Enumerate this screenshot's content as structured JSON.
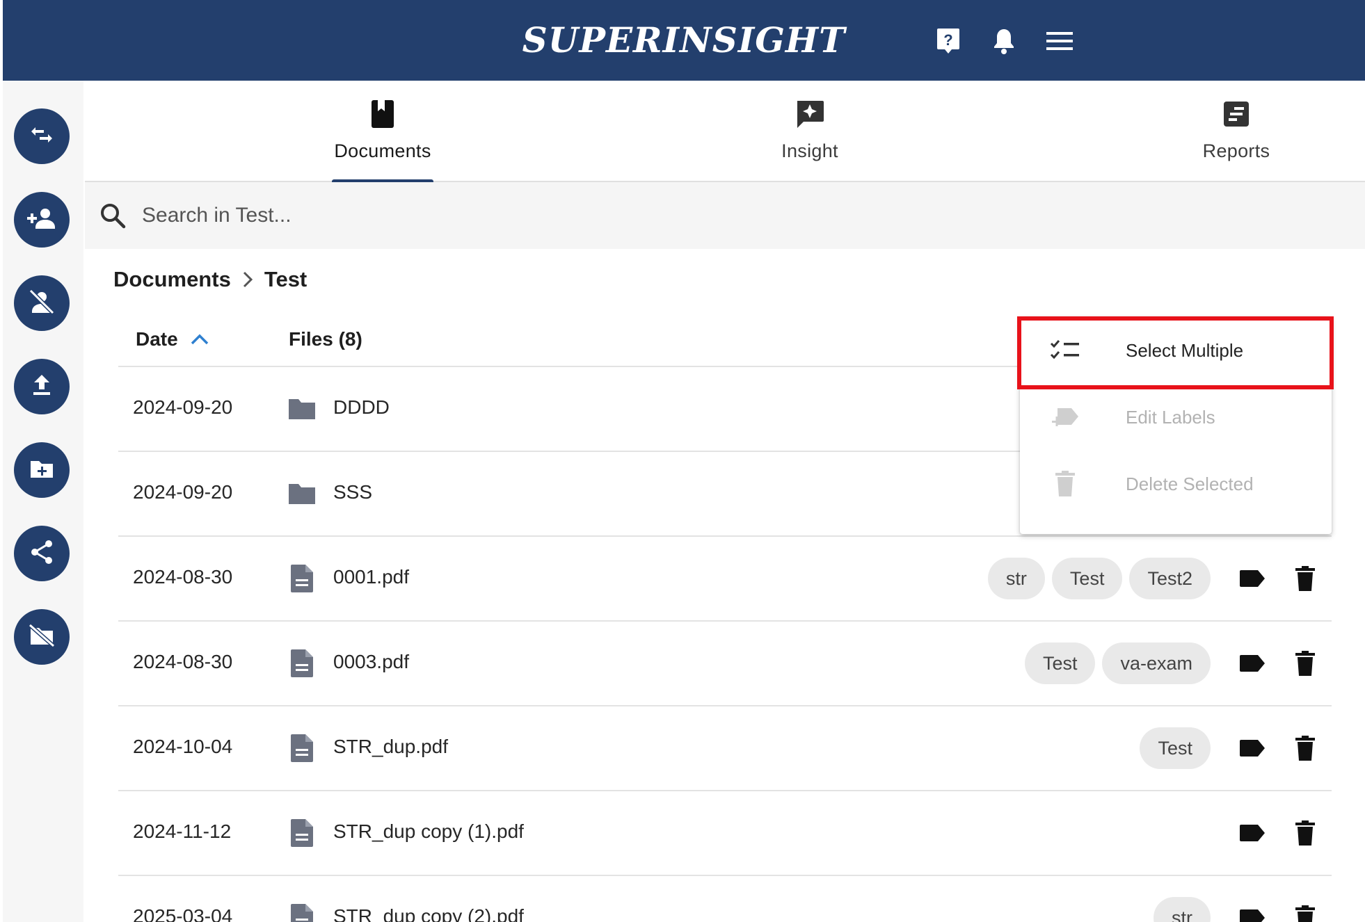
{
  "header": {
    "brand": "SUPERINSIGHT",
    "icons": [
      "help-icon",
      "bell-icon",
      "menu-icon"
    ],
    "color": "#233f6d"
  },
  "sidebar": {
    "buttons": [
      "swap-icon",
      "person-add-icon",
      "person-off-icon",
      "upload-icon",
      "folder-add-icon",
      "share-icon",
      "no-folder-icon"
    ]
  },
  "tabs": [
    {
      "label": "Documents",
      "icon": "book-icon",
      "active": true
    },
    {
      "label": "Insight",
      "icon": "sparkle-chat-icon",
      "active": false
    },
    {
      "label": "Reports",
      "icon": "report-icon",
      "active": false
    }
  ],
  "search": {
    "placeholder": "Search in Test..."
  },
  "breadcrumb": {
    "root": "Documents",
    "current": "Test"
  },
  "table": {
    "date_header": "Date",
    "files_header": "Files (8)",
    "sort": "ascending",
    "rows": [
      {
        "date": "2024-09-20",
        "name": "DDDD",
        "type": "folder",
        "labels": []
      },
      {
        "date": "2024-09-20",
        "name": "SSS",
        "type": "folder",
        "labels": []
      },
      {
        "date": "2024-08-30",
        "name": "0001.pdf",
        "type": "file",
        "labels": [
          "str",
          "Test",
          "Test2"
        ]
      },
      {
        "date": "2024-08-30",
        "name": "0003.pdf",
        "type": "file",
        "labels": [
          "Test",
          "va-exam"
        ]
      },
      {
        "date": "2024-10-04",
        "name": "STR_dup.pdf",
        "type": "file",
        "labels": [
          "Test"
        ]
      },
      {
        "date": "2024-11-12",
        "name": "STR_dup copy (1).pdf",
        "type": "file",
        "labels": []
      },
      {
        "date": "2025-03-04",
        "name": "STR_dup copy (2).pdf",
        "type": "file",
        "labels": [
          "str"
        ]
      }
    ]
  },
  "menu": {
    "items": [
      {
        "label": "Select Multiple",
        "icon": "checklist-icon",
        "disabled": false
      },
      {
        "label": "Edit Labels",
        "icon": "label-add-icon",
        "disabled": true
      },
      {
        "label": "Delete Selected",
        "icon": "trash-icon",
        "disabled": true
      }
    ],
    "highlight_color": "#e8121a"
  }
}
